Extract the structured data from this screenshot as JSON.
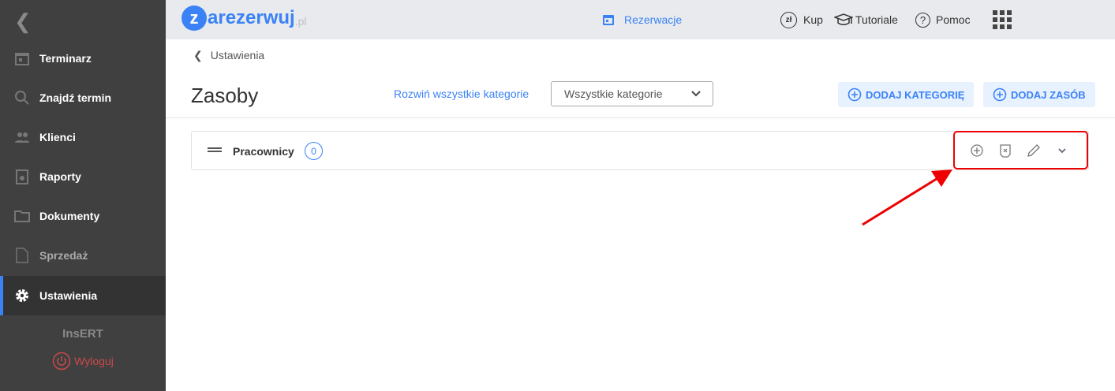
{
  "sidebar": {
    "items": [
      {
        "label": "Terminarz",
        "icon": "calendar-icon"
      },
      {
        "label": "Znajdź termin",
        "icon": "search-icon"
      },
      {
        "label": "Klienci",
        "icon": "users-icon"
      },
      {
        "label": "Raporty",
        "icon": "report-icon"
      },
      {
        "label": "Dokumenty",
        "icon": "folder-icon"
      },
      {
        "label": "Sprzedaż",
        "icon": "document-icon"
      },
      {
        "label": "Ustawienia",
        "icon": "gear-icon"
      }
    ],
    "company": "InsERT",
    "logout": "Wyloguj"
  },
  "header": {
    "logo_letter": "z",
    "logo_text": "arezerwuj",
    "logo_tld": ".pl",
    "reservations": "Rezerwacje",
    "buy": "Kup",
    "buy_icon": "zł",
    "tutorials": "Tutoriale",
    "help": "Pomoc"
  },
  "main": {
    "breadcrumb": "Ustawienia",
    "title": "Zasoby",
    "expand_all": "Rozwiń wszystkie kategorie",
    "category_select": "Wszystkie kategorie",
    "add_category": "DODAJ KATEGORIĘ",
    "add_resource": "DODAJ ZASÓB",
    "categories": [
      {
        "name": "Pracownicy",
        "count": "0"
      }
    ]
  },
  "colors": {
    "accent": "#3b82f6",
    "sidebar": "#404040",
    "highlight": "#ee0000"
  }
}
